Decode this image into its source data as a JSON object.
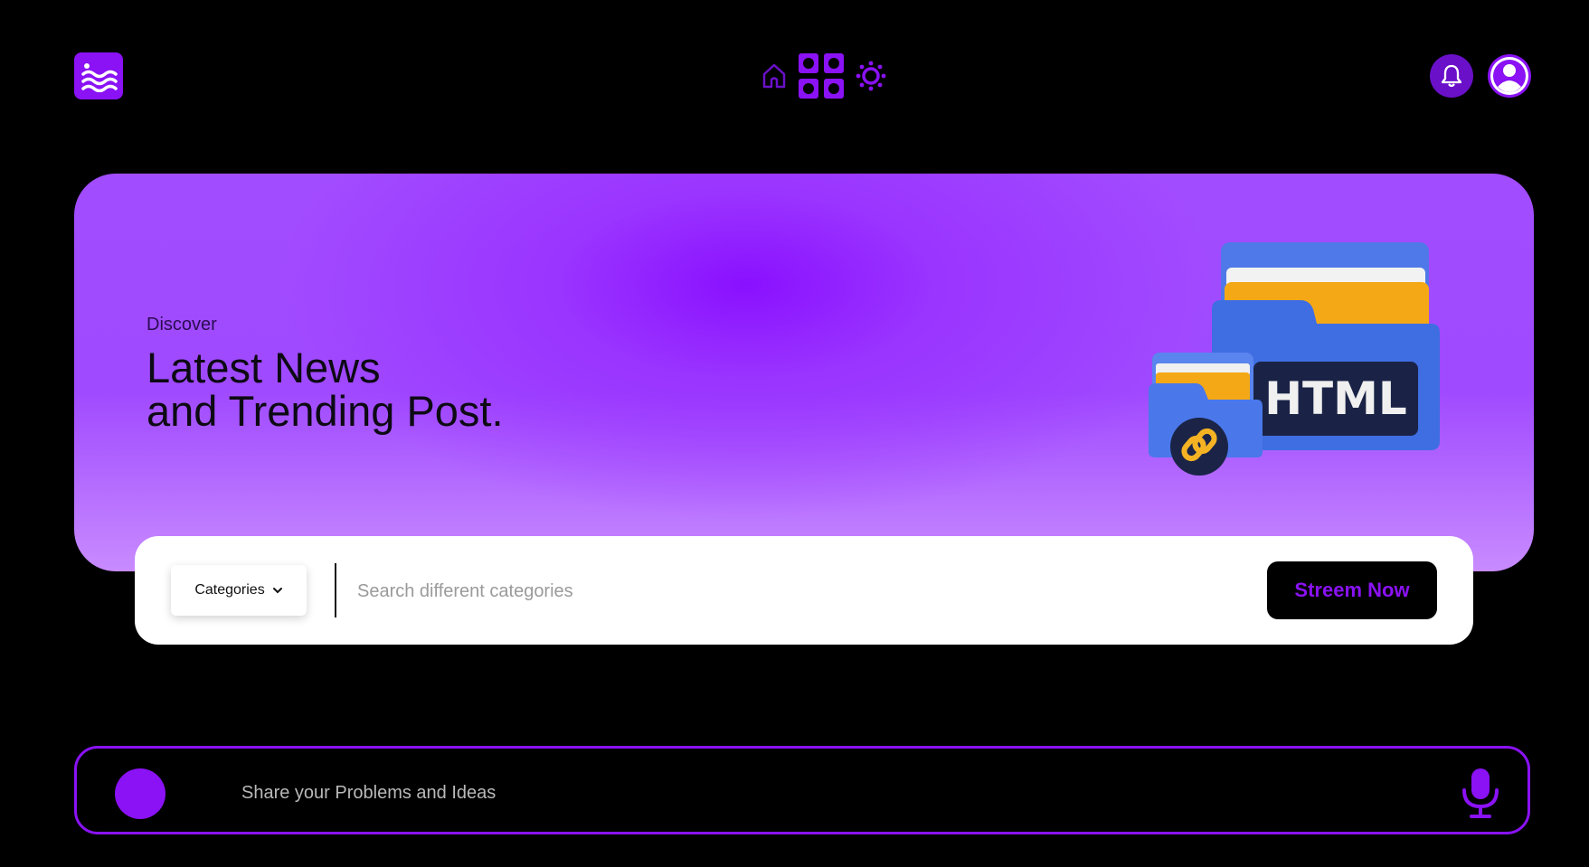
{
  "header": {
    "logo_icon": "waves-logo-icon",
    "nav": [
      {
        "icon": "home-icon"
      },
      {
        "icon": "grid-icon"
      },
      {
        "icon": "sun-icon"
      }
    ],
    "actions": [
      {
        "icon": "bell-icon"
      },
      {
        "icon": "user-icon"
      }
    ]
  },
  "hero": {
    "eyebrow": "Discover",
    "headline_line1": "Latest News",
    "headline_line2": "and Trending Post.",
    "illustration": {
      "badge_text": "HTML",
      "icon": "folder-html-icon"
    }
  },
  "search": {
    "category_label": "Categories",
    "placeholder": "Search different categories",
    "cta_label": "Streem Now"
  },
  "composer": {
    "placeholder": "Share your Problems and Ideas",
    "mic_icon": "microphone-icon"
  },
  "colors": {
    "accent": "#8a12f4",
    "background": "#000000",
    "hero_gradient_top": "#a24cff",
    "hero_gradient_bottom": "#c88bff"
  }
}
